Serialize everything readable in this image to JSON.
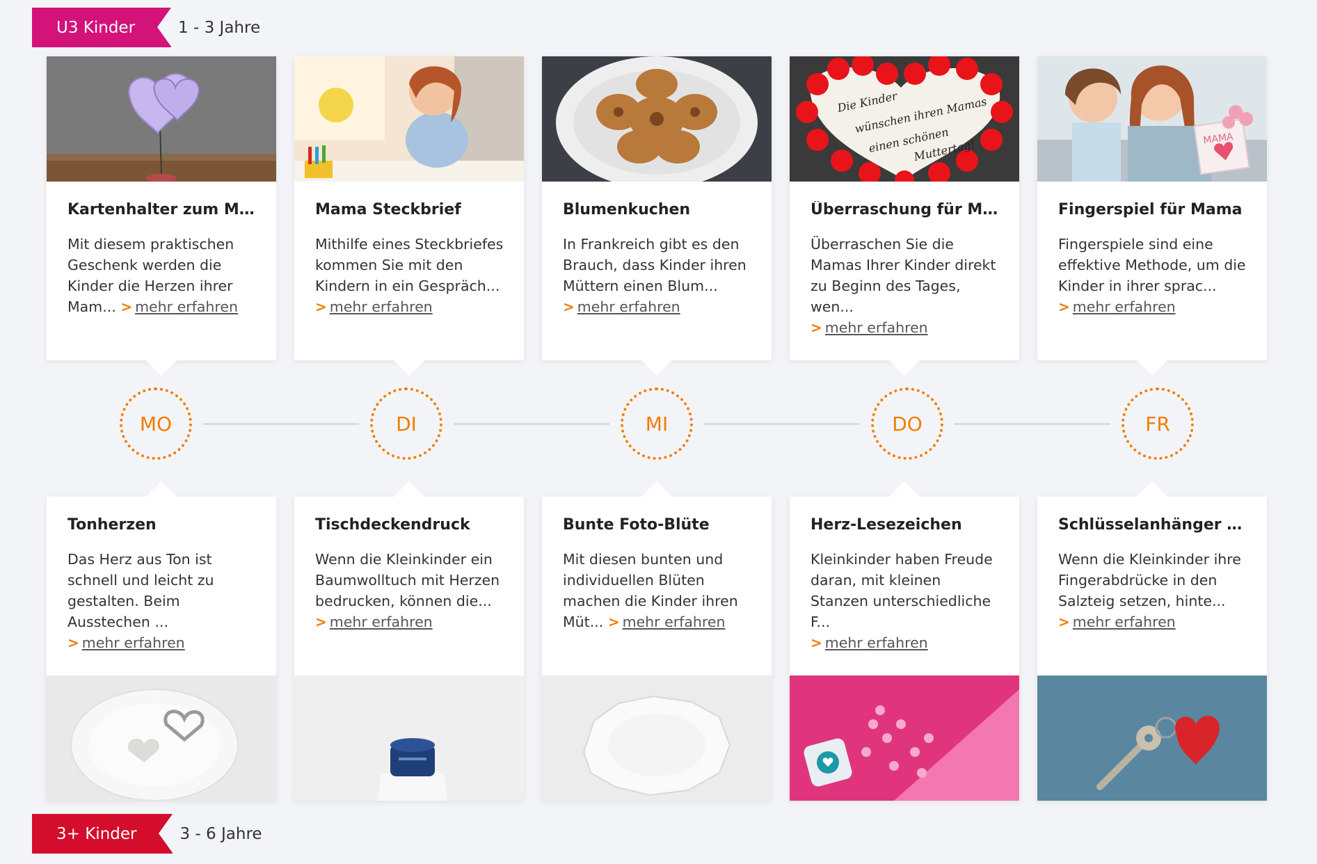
{
  "sections": {
    "u3": {
      "label": "U3 Kinder",
      "age": "1 - 3 Jahre",
      "color": "#d3127a"
    },
    "plus3": {
      "label": "3+ Kinder",
      "age": "3 - 6 Jahre",
      "color": "#d30d2b"
    }
  },
  "more_label": "mehr erfahren",
  "accent_color": "#f07d00",
  "days": [
    "MO",
    "DI",
    "MI",
    "DO",
    "FR"
  ],
  "top_cards": [
    {
      "title": "Kartenhalter zum Mutt...",
      "text": "Mit diesem praktischen Geschenk werden die Kinder die Herzen ihrer Mam...",
      "image": "paper-heart-card-holder"
    },
    {
      "title": "Mama Steckbrief",
      "text": "Mithilfe eines Steckbriefes kommen Sie mit den Kindern in ein Gespräch...",
      "image": "child-drawing"
    },
    {
      "title": "Blumenkuchen",
      "text": "In Frankreich gibt es den Brauch, dass Kinder ihren Müttern einen Blum...",
      "image": "flower-pastry-plate"
    },
    {
      "title": "Überraschung für Mam...",
      "text": "Überraschen Sie die Mamas Ihrer Kinder direkt zu Beginn des Tages, wen...",
      "image": "red-flower-heart-sign",
      "image_text": [
        "Die Kinder",
        "wünschen ihren Mamas",
        "einen schönen",
        "Muttertag!"
      ]
    },
    {
      "title": "Fingerspiel für Mama",
      "text": "Fingerspiele sind eine effektive Methode, um die Kinder in ihrer sprac...",
      "image": "mother-daughter-hug",
      "image_text": [
        "MAMA"
      ]
    }
  ],
  "bottom_cards": [
    {
      "title": "Tonherzen",
      "text": "Das Herz aus Ton ist schnell und leicht zu gestalten. Beim Ausstechen ...",
      "image": "clay-heart-plate"
    },
    {
      "title": "Tischdeckendruck",
      "text": "Wenn die Kleinkinder ein Baumwolltuch mit Herzen bedrucken, können die...",
      "image": "paint-bottle"
    },
    {
      "title": "Bunte Foto-Blüte",
      "text": "Mit diesen bunten und individuellen Blüten machen die Kinder ihren Müt...",
      "image": "paper-plate"
    },
    {
      "title": "Herz-Lesezeichen",
      "text": "Kleinkinder haben Freude daran, mit kleinen Stanzen unterschiedliche F...",
      "image": "heart-punch-pink"
    },
    {
      "title": "Schlüsselanhänger mit...",
      "text": "Wenn die Kleinkinder ihre Fingerabdrücke in den Salzteig setzen, hinte...",
      "image": "key-heart-keychain"
    }
  ]
}
